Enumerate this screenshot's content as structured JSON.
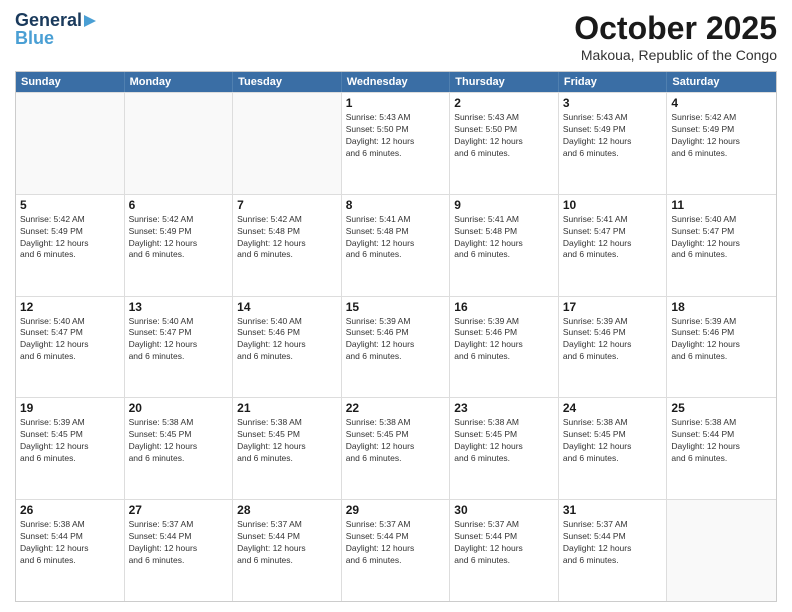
{
  "logo": {
    "line1": "General",
    "line2": "Blue"
  },
  "title": "October 2025",
  "location": "Makoua, Republic of the Congo",
  "days_header": [
    "Sunday",
    "Monday",
    "Tuesday",
    "Wednesday",
    "Thursday",
    "Friday",
    "Saturday"
  ],
  "weeks": [
    [
      {
        "day": "",
        "text": ""
      },
      {
        "day": "",
        "text": ""
      },
      {
        "day": "",
        "text": ""
      },
      {
        "day": "1",
        "text": "Sunrise: 5:43 AM\nSunset: 5:50 PM\nDaylight: 12 hours\nand 6 minutes."
      },
      {
        "day": "2",
        "text": "Sunrise: 5:43 AM\nSunset: 5:50 PM\nDaylight: 12 hours\nand 6 minutes."
      },
      {
        "day": "3",
        "text": "Sunrise: 5:43 AM\nSunset: 5:49 PM\nDaylight: 12 hours\nand 6 minutes."
      },
      {
        "day": "4",
        "text": "Sunrise: 5:42 AM\nSunset: 5:49 PM\nDaylight: 12 hours\nand 6 minutes."
      }
    ],
    [
      {
        "day": "5",
        "text": "Sunrise: 5:42 AM\nSunset: 5:49 PM\nDaylight: 12 hours\nand 6 minutes."
      },
      {
        "day": "6",
        "text": "Sunrise: 5:42 AM\nSunset: 5:49 PM\nDaylight: 12 hours\nand 6 minutes."
      },
      {
        "day": "7",
        "text": "Sunrise: 5:42 AM\nSunset: 5:48 PM\nDaylight: 12 hours\nand 6 minutes."
      },
      {
        "day": "8",
        "text": "Sunrise: 5:41 AM\nSunset: 5:48 PM\nDaylight: 12 hours\nand 6 minutes."
      },
      {
        "day": "9",
        "text": "Sunrise: 5:41 AM\nSunset: 5:48 PM\nDaylight: 12 hours\nand 6 minutes."
      },
      {
        "day": "10",
        "text": "Sunrise: 5:41 AM\nSunset: 5:47 PM\nDaylight: 12 hours\nand 6 minutes."
      },
      {
        "day": "11",
        "text": "Sunrise: 5:40 AM\nSunset: 5:47 PM\nDaylight: 12 hours\nand 6 minutes."
      }
    ],
    [
      {
        "day": "12",
        "text": "Sunrise: 5:40 AM\nSunset: 5:47 PM\nDaylight: 12 hours\nand 6 minutes."
      },
      {
        "day": "13",
        "text": "Sunrise: 5:40 AM\nSunset: 5:47 PM\nDaylight: 12 hours\nand 6 minutes."
      },
      {
        "day": "14",
        "text": "Sunrise: 5:40 AM\nSunset: 5:46 PM\nDaylight: 12 hours\nand 6 minutes."
      },
      {
        "day": "15",
        "text": "Sunrise: 5:39 AM\nSunset: 5:46 PM\nDaylight: 12 hours\nand 6 minutes."
      },
      {
        "day": "16",
        "text": "Sunrise: 5:39 AM\nSunset: 5:46 PM\nDaylight: 12 hours\nand 6 minutes."
      },
      {
        "day": "17",
        "text": "Sunrise: 5:39 AM\nSunset: 5:46 PM\nDaylight: 12 hours\nand 6 minutes."
      },
      {
        "day": "18",
        "text": "Sunrise: 5:39 AM\nSunset: 5:46 PM\nDaylight: 12 hours\nand 6 minutes."
      }
    ],
    [
      {
        "day": "19",
        "text": "Sunrise: 5:39 AM\nSunset: 5:45 PM\nDaylight: 12 hours\nand 6 minutes."
      },
      {
        "day": "20",
        "text": "Sunrise: 5:38 AM\nSunset: 5:45 PM\nDaylight: 12 hours\nand 6 minutes."
      },
      {
        "day": "21",
        "text": "Sunrise: 5:38 AM\nSunset: 5:45 PM\nDaylight: 12 hours\nand 6 minutes."
      },
      {
        "day": "22",
        "text": "Sunrise: 5:38 AM\nSunset: 5:45 PM\nDaylight: 12 hours\nand 6 minutes."
      },
      {
        "day": "23",
        "text": "Sunrise: 5:38 AM\nSunset: 5:45 PM\nDaylight: 12 hours\nand 6 minutes."
      },
      {
        "day": "24",
        "text": "Sunrise: 5:38 AM\nSunset: 5:45 PM\nDaylight: 12 hours\nand 6 minutes."
      },
      {
        "day": "25",
        "text": "Sunrise: 5:38 AM\nSunset: 5:44 PM\nDaylight: 12 hours\nand 6 minutes."
      }
    ],
    [
      {
        "day": "26",
        "text": "Sunrise: 5:38 AM\nSunset: 5:44 PM\nDaylight: 12 hours\nand 6 minutes."
      },
      {
        "day": "27",
        "text": "Sunrise: 5:37 AM\nSunset: 5:44 PM\nDaylight: 12 hours\nand 6 minutes."
      },
      {
        "day": "28",
        "text": "Sunrise: 5:37 AM\nSunset: 5:44 PM\nDaylight: 12 hours\nand 6 minutes."
      },
      {
        "day": "29",
        "text": "Sunrise: 5:37 AM\nSunset: 5:44 PM\nDaylight: 12 hours\nand 6 minutes."
      },
      {
        "day": "30",
        "text": "Sunrise: 5:37 AM\nSunset: 5:44 PM\nDaylight: 12 hours\nand 6 minutes."
      },
      {
        "day": "31",
        "text": "Sunrise: 5:37 AM\nSunset: 5:44 PM\nDaylight: 12 hours\nand 6 minutes."
      },
      {
        "day": "",
        "text": ""
      }
    ]
  ]
}
